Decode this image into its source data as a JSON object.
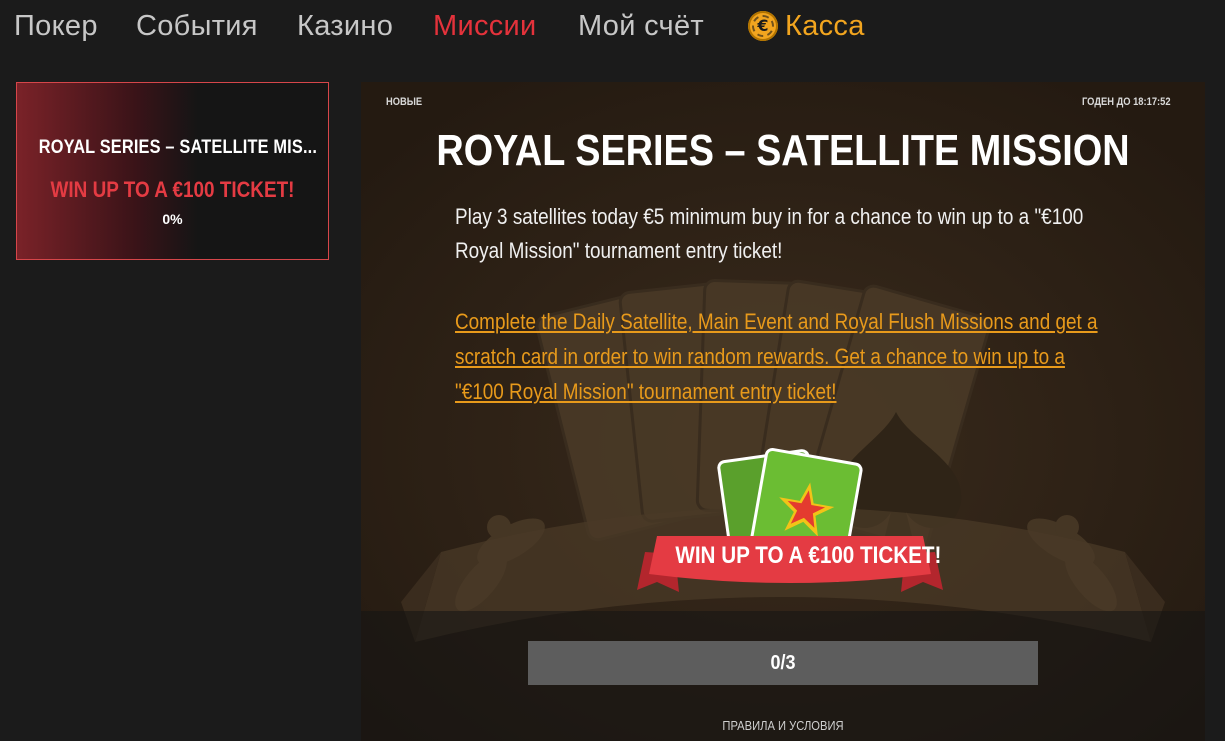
{
  "nav": {
    "items": [
      {
        "label": "Покер"
      },
      {
        "label": "События"
      },
      {
        "label": "Казино"
      },
      {
        "label": "Миссии"
      },
      {
        "label": "Мой счёт"
      },
      {
        "label": "Касса"
      }
    ],
    "active_item": "Миссии",
    "cashier_icon": "coin-icon",
    "colors": {
      "active": "#e4323b",
      "cashier": "#f2a51f",
      "default": "#c7c7c7"
    }
  },
  "mission_card": {
    "title": "ROYAL SERIES – SATELLITE MIS...",
    "subtitle": "WIN UP TO A €100 TICKET!",
    "progress": "0%"
  },
  "mission": {
    "status": "НОВЫЕ",
    "valid_until": "ГОДЕН ДО 18:17:52",
    "title": "ROYAL SERIES – SATELLITE MISSION",
    "description": "Play 3 satellites today €5 minimum buy in for a chance to win up to a \"€100 Royal Mission\" tournament entry ticket!",
    "link_text": "Complete the Daily Satellite, Main Event and Royal Flush Missions and get a scratch card in order to win random rewards. Get a chance to win up to a \"€100 Royal Mission\" tournament entry ticket!",
    "badge_text": "WIN UP TO A €100 TICKET!",
    "badge_icon": "ticket-star-icon",
    "progress_text": "0/3",
    "progress_fraction": 0,
    "terms": "ПРАВИЛА И УСЛОВИЯ",
    "colors": {
      "accent": "#e43b43",
      "link": "#e89a1b"
    }
  }
}
